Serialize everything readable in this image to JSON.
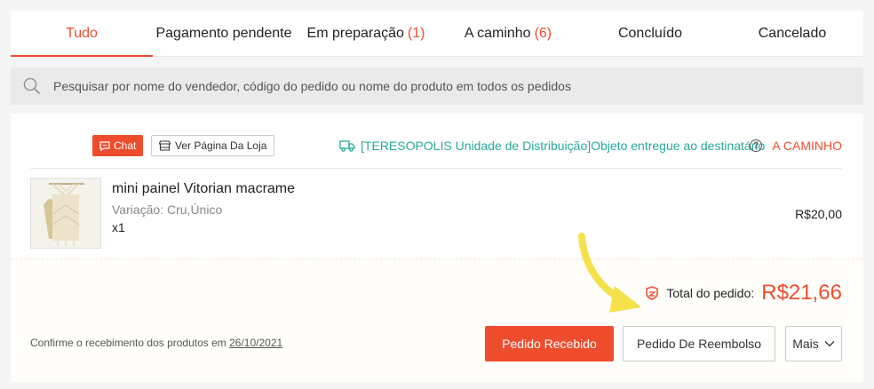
{
  "tabs": [
    {
      "label": "Tudo",
      "count": ""
    },
    {
      "label": "Pagamento pendente",
      "count": ""
    },
    {
      "label": "Em preparação",
      "count": "(1)"
    },
    {
      "label": "A caminho",
      "count": "(6)"
    },
    {
      "label": "Concluído",
      "count": ""
    },
    {
      "label": "Cancelado",
      "count": ""
    }
  ],
  "search": {
    "placeholder": "Pesquisar por nome do vendedor, código do pedido ou nome do produto em todos os pedidos",
    "icon": "search-icon"
  },
  "order": {
    "chat_label": "Chat",
    "shop_label": "Ver Página Da Loja",
    "delivery_text": "[TERESOPOLIS Unidade de Distribuição]Objeto entregue ao destinatário",
    "help_symbol": "?",
    "status": "A CAMINHO",
    "product": {
      "name": "mini painel Vitorian macrame",
      "variation": "Variação: Cru,Único",
      "quantity": "x1",
      "price": "R$20,00"
    },
    "total_label": "Total do pedido:",
    "total_value": "R$21,66",
    "confirm_text": "Confirme o recebimento dos produtos em ",
    "confirm_date": "26/10/2021",
    "received_button": "Pedido Recebido",
    "refund_button": "Pedido De Reembolso",
    "more_button": "Mais"
  },
  "colors": {
    "accent": "#ee4d2d",
    "delivery": "#26aa99",
    "annotation_arrow": "#f5e14a"
  }
}
